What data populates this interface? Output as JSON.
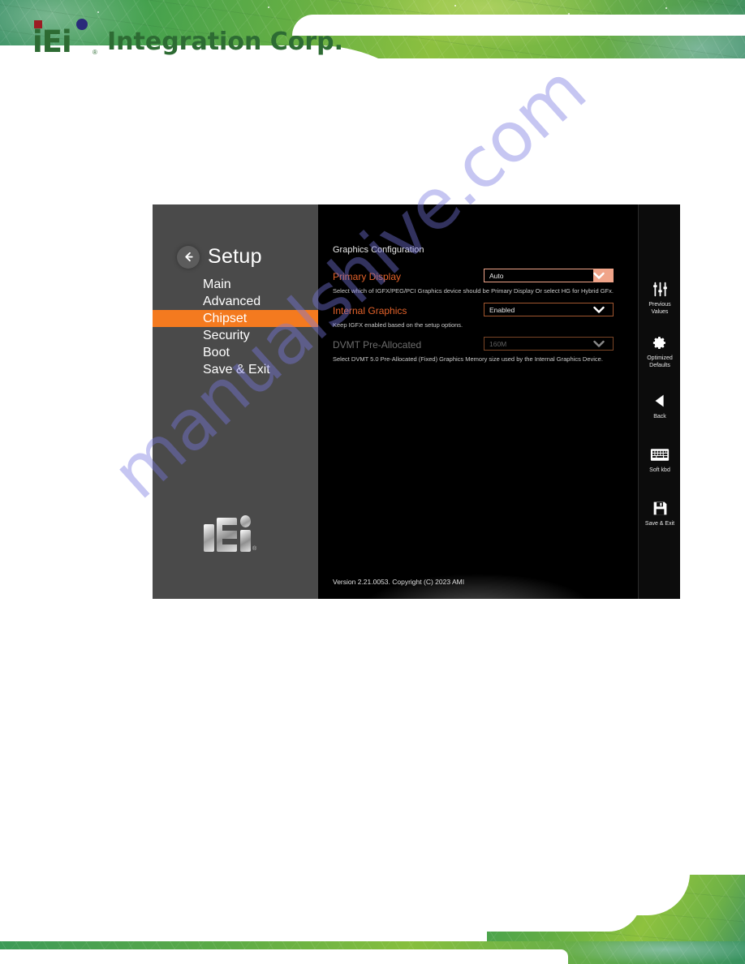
{
  "brand": {
    "logo_initials": "iEi",
    "logo_word": "Integration Corp.",
    "registered_mark": "®"
  },
  "bios": {
    "nav": {
      "title": "Setup",
      "back_icon": "arrow-left-icon",
      "items": [
        {
          "label": "Main",
          "active": false
        },
        {
          "label": "Advanced",
          "active": false
        },
        {
          "label": "Chipset",
          "active": true
        },
        {
          "label": "Security",
          "active": false
        },
        {
          "label": "Boot",
          "active": false
        },
        {
          "label": "Save & Exit",
          "active": false
        }
      ],
      "logo_initials": "iEi"
    },
    "main": {
      "section_title": "Graphics Configuration",
      "options": [
        {
          "label": "Primary Display",
          "value": "Auto",
          "help": "Select which of IGFX/PEG/PCI Graphics device should be Primary Display Or select HG for Hybrid GFx.",
          "state": "selected"
        },
        {
          "label": "Internal Graphics",
          "value": "Enabled",
          "help": "Keep IGFX enabled based on the setup options.",
          "state": "normal"
        },
        {
          "label": "DVMT Pre-Allocated",
          "value": "160M",
          "help": "Select DVMT 5.0 Pre-Allocated (Fixed) Graphics Memory size used by the Internal Graphics Device.",
          "state": "disabled"
        }
      ],
      "version": "Version 2.21.0053. Copyright (C) 2023 AMI"
    },
    "tools": [
      {
        "label": "Previous\nValues",
        "icon": "sliders-icon"
      },
      {
        "label": "Optimized\nDefaults",
        "icon": "gear-icon"
      },
      {
        "label": "Back",
        "icon": "triangle-left-icon"
      },
      {
        "label": "Soft kbd",
        "icon": "keyboard-icon"
      },
      {
        "label": "Save & Exit",
        "icon": "floppy-disk-icon"
      }
    ]
  },
  "watermark": {
    "text": "manualshive.com"
  },
  "colors": {
    "accent_orange": "#f47a1f",
    "label_orange": "#e3622a",
    "dropdown_selected": "#f0a489",
    "nav_bg": "#4a4a4a",
    "panel_bg": "#000000",
    "brand_green": "#2d6b33"
  }
}
